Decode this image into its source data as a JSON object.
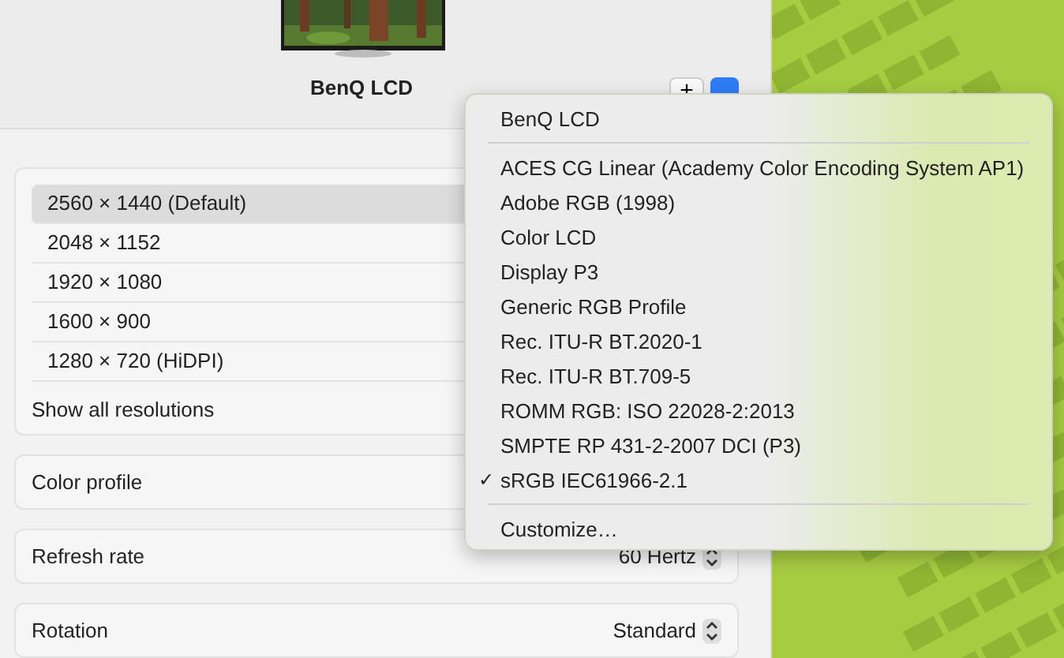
{
  "display": {
    "name": "BenQ LCD"
  },
  "header_buttons": [
    {
      "kind": "add",
      "label": "+"
    },
    {
      "kind": "menu"
    }
  ],
  "resolutions": [
    {
      "label": "2560 × 1440 (Default)",
      "selected": true
    },
    {
      "label": "2048 × 1152",
      "selected": false
    },
    {
      "label": "1920 × 1080",
      "selected": false
    },
    {
      "label": "1600 × 900",
      "selected": false
    },
    {
      "label": "1280 × 720 (HiDPI)",
      "selected": false
    }
  ],
  "show_all_resolutions": "Show all resolutions",
  "settings": [
    {
      "label": "Color profile"
    },
    {
      "label": "Refresh rate",
      "value": "60 Hertz"
    },
    {
      "label": "Rotation",
      "value": "Standard"
    }
  ],
  "color_profile_menu": {
    "check_symbol": "✓",
    "sections": [
      [
        {
          "label": "BenQ LCD",
          "checked": false
        }
      ],
      [
        {
          "label": "ACES CG Linear (Academy Color Encoding System AP1)",
          "checked": false
        },
        {
          "label": "Adobe RGB (1998)",
          "checked": false
        },
        {
          "label": "Color LCD",
          "checked": false
        },
        {
          "label": "Display P3",
          "checked": false
        },
        {
          "label": "Generic RGB Profile",
          "checked": false
        },
        {
          "label": "Rec. ITU-R BT.2020-1",
          "checked": false
        },
        {
          "label": "Rec. ITU-R BT.709-5",
          "checked": false
        },
        {
          "label": "ROMM RGB: ISO 22028-2:2013",
          "checked": false
        },
        {
          "label": "SMPTE RP 431-2-2007 DCI (P3)",
          "checked": false
        },
        {
          "label": "sRGB IEC61966-2.1",
          "checked": true
        }
      ],
      [
        {
          "label": "Customize…",
          "checked": false
        }
      ]
    ]
  }
}
